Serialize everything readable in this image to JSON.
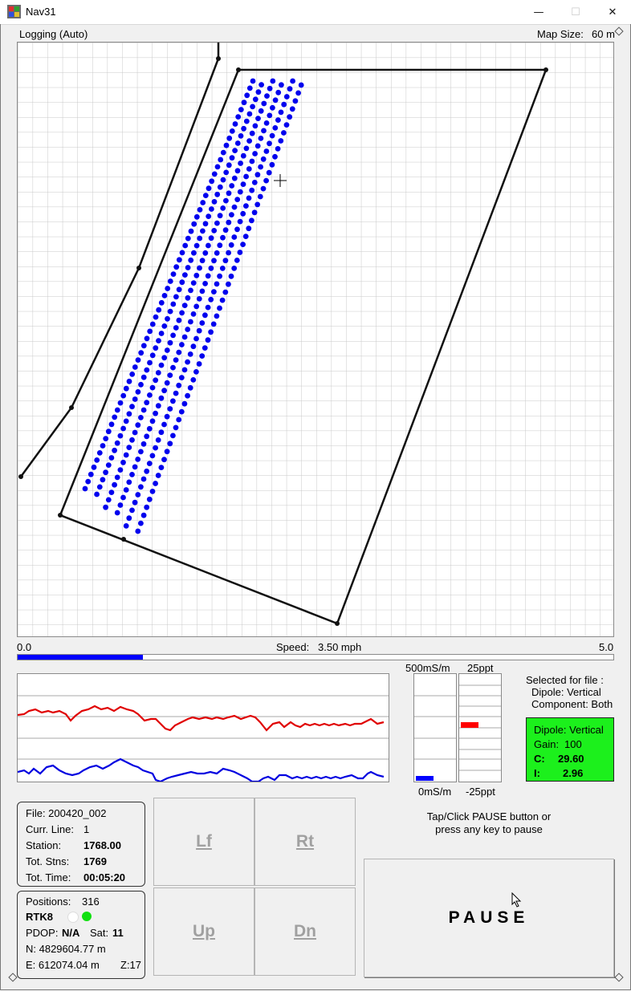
{
  "window": {
    "title": "Nav31",
    "icon": "nav31-app-icon",
    "minimize": "—",
    "maximize": "☐",
    "close": "✕"
  },
  "status": {
    "mode": "Logging (Auto)",
    "map_size_label": "Map Size:",
    "map_size_value": "60 m"
  },
  "speed": {
    "min": "0.0",
    "max": "5.0",
    "label": "Speed:",
    "value": "3.50 mph",
    "fraction": 0.21,
    "bar_color": "#0000ff"
  },
  "graph": {
    "series": [
      {
        "color": "#e00000"
      },
      {
        "color": "#0000e0"
      }
    ]
  },
  "meters": {
    "conductivity_top": "500mS/m",
    "conductivity_bottom": "0mS/m",
    "inphase_top": "25ppt",
    "inphase_bottom": "-25ppt"
  },
  "selection": {
    "heading": "Selected for file :",
    "dipole": "Dipole: Vertical",
    "component": "Component: Both"
  },
  "readout": {
    "dipole": "Dipole: Vertical",
    "gain_label": "Gain:",
    "gain_value": "100",
    "c_label": "C:",
    "c_value": "29.60",
    "i_label": "I:",
    "i_value": "2.96",
    "color": "#1cf01c"
  },
  "file_info": {
    "file": "File: 200420_002",
    "curr_line_label": "Curr. Line:",
    "curr_line_value": "1",
    "station_label": "Station:",
    "station_value": "1768.00",
    "tot_stns_label": "Tot. Stns:",
    "tot_stns_value": "1769",
    "tot_time_label": "Tot. Time:",
    "tot_time_value": "00:05:20"
  },
  "gps": {
    "positions_label": "Positions:",
    "positions_value": "316",
    "fix": "RTK8",
    "pdop_label": "PDOP:",
    "pdop_value": "N/A",
    "sat_label": "Sat:",
    "sat_value": "11",
    "northing": "N:  4829604.77 m",
    "easting": "E:   612074.04 m",
    "zone": "Z:17",
    "led1_color": "#ffffff",
    "led2_color": "#11e011"
  },
  "nav_buttons": {
    "left": "Lf",
    "right": "Rt",
    "up": "Up",
    "down": "Dn"
  },
  "pause": {
    "hint_line1": "Tap/Click PAUSE button or",
    "hint_line2": "press any key to pause",
    "label": "PAUSE"
  }
}
